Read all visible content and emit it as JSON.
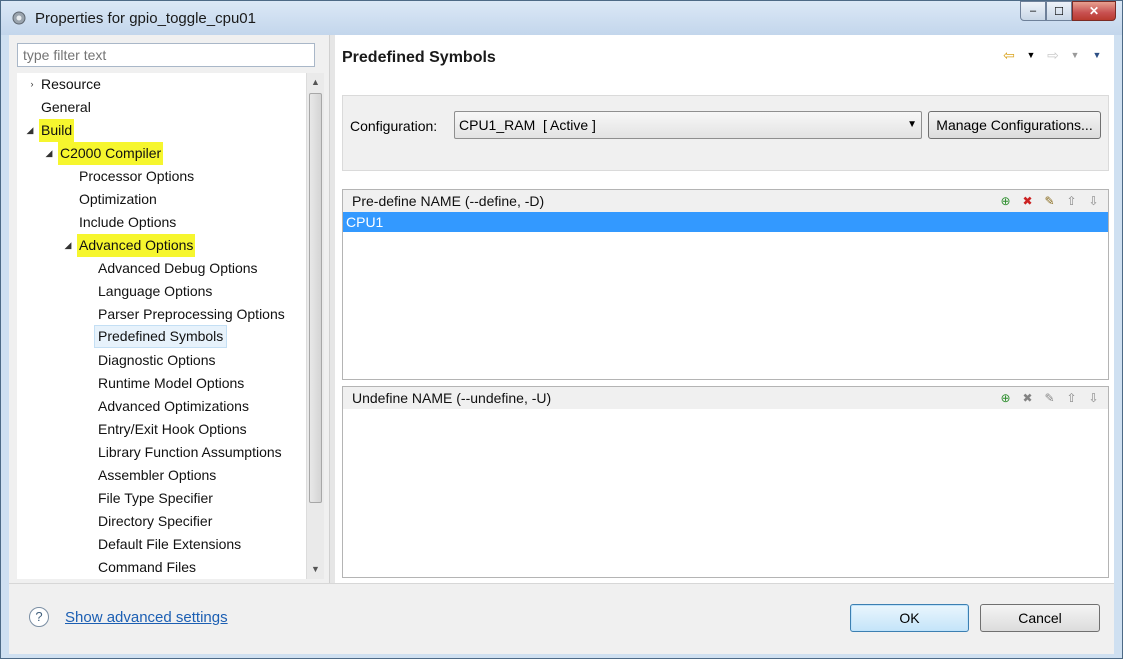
{
  "window": {
    "title": "Properties for gpio_toggle_cpu01",
    "minimize": "–",
    "maximize": "☐",
    "close": "✕"
  },
  "filter": {
    "placeholder": "type filter text"
  },
  "tree": {
    "resource": "Resource",
    "general": "General",
    "build": "Build",
    "compiler": "C2000 Compiler",
    "processor_options": "Processor Options",
    "optimization": "Optimization",
    "include_options": "Include Options",
    "advanced_options": "Advanced Options",
    "advanced_debug_options": "Advanced Debug Options",
    "language_options": "Language Options",
    "parser_preprocessing_options": "Parser Preprocessing Options",
    "predefined_symbols": "Predefined Symbols",
    "diagnostic_options": "Diagnostic Options",
    "runtime_model_options": "Runtime Model Options",
    "advanced_optimizations": "Advanced Optimizations",
    "entry_exit_hook_options": "Entry/Exit Hook Options",
    "library_function_assumptions": "Library Function Assumptions",
    "assembler_options": "Assembler Options",
    "file_type_specifier": "File Type Specifier",
    "directory_specifier": "Directory Specifier",
    "default_file_extensions": "Default File Extensions",
    "command_files": "Command Files"
  },
  "page": {
    "title": "Predefined Symbols"
  },
  "config": {
    "label": "Configuration:",
    "value": "CPU1_RAM  [ Active ]",
    "manage_button": "Manage Configurations..."
  },
  "predefine": {
    "title": "Pre-define NAME (--define, -D)",
    "items": [
      "CPU1"
    ]
  },
  "undefine": {
    "title": "Undefine NAME (--undefine, -U)"
  },
  "footer": {
    "help": "?",
    "advanced_link": "Show advanced settings",
    "ok": "OK",
    "cancel": "Cancel"
  },
  "colors": {
    "highlight": "#f6f62e",
    "selection": "#3399ff",
    "link": "#1c5fb3"
  }
}
